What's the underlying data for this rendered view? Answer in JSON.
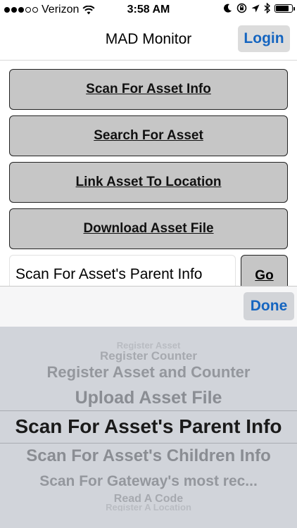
{
  "status_bar": {
    "signal_dots_full": 3,
    "signal_dots_total": 5,
    "carrier": "Verizon",
    "time": "3:58 AM",
    "icons": [
      "wifi-icon",
      "moon-icon",
      "rotation-lock-icon",
      "location-arrow-icon",
      "bluetooth-icon",
      "battery-icon"
    ],
    "battery_level": 0.9
  },
  "nav": {
    "title": "MAD Monitor",
    "login_label": "Login"
  },
  "menu_buttons": [
    "Scan For Asset Info",
    "Search For Asset",
    "Link Asset To Location",
    "Download Asset File"
  ],
  "selection": {
    "value": "Scan For Asset's Parent Info",
    "go_label": "Go"
  },
  "picker": {
    "done_label": "Done",
    "options": [
      "Register Asset",
      "Register Counter",
      "Register Asset and Counter",
      "Upload Asset File",
      "Scan For Asset's Parent Info",
      "Scan For Asset's Children Info",
      "Scan For Gateway's most rec...",
      "Read A Code",
      "Register A Location"
    ],
    "selected_index": 4
  },
  "colors": {
    "accent": "#1565c0",
    "button_fill": "#c6c6c6",
    "picker_bg": "#d1d4da"
  }
}
